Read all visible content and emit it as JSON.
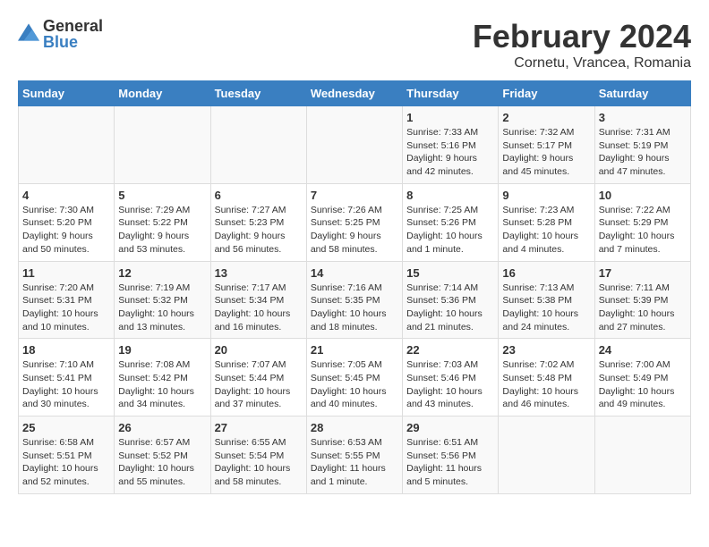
{
  "logo": {
    "text_general": "General",
    "text_blue": "Blue"
  },
  "title": "February 2024",
  "subtitle": "Cornetu, Vrancea, Romania",
  "days_of_week": [
    "Sunday",
    "Monday",
    "Tuesday",
    "Wednesday",
    "Thursday",
    "Friday",
    "Saturday"
  ],
  "weeks": [
    [
      {
        "day": "",
        "info": ""
      },
      {
        "day": "",
        "info": ""
      },
      {
        "day": "",
        "info": ""
      },
      {
        "day": "",
        "info": ""
      },
      {
        "day": "1",
        "info": "Sunrise: 7:33 AM\nSunset: 5:16 PM\nDaylight: 9 hours\nand 42 minutes."
      },
      {
        "day": "2",
        "info": "Sunrise: 7:32 AM\nSunset: 5:17 PM\nDaylight: 9 hours\nand 45 minutes."
      },
      {
        "day": "3",
        "info": "Sunrise: 7:31 AM\nSunset: 5:19 PM\nDaylight: 9 hours\nand 47 minutes."
      }
    ],
    [
      {
        "day": "4",
        "info": "Sunrise: 7:30 AM\nSunset: 5:20 PM\nDaylight: 9 hours\nand 50 minutes."
      },
      {
        "day": "5",
        "info": "Sunrise: 7:29 AM\nSunset: 5:22 PM\nDaylight: 9 hours\nand 53 minutes."
      },
      {
        "day": "6",
        "info": "Sunrise: 7:27 AM\nSunset: 5:23 PM\nDaylight: 9 hours\nand 56 minutes."
      },
      {
        "day": "7",
        "info": "Sunrise: 7:26 AM\nSunset: 5:25 PM\nDaylight: 9 hours\nand 58 minutes."
      },
      {
        "day": "8",
        "info": "Sunrise: 7:25 AM\nSunset: 5:26 PM\nDaylight: 10 hours\nand 1 minute."
      },
      {
        "day": "9",
        "info": "Sunrise: 7:23 AM\nSunset: 5:28 PM\nDaylight: 10 hours\nand 4 minutes."
      },
      {
        "day": "10",
        "info": "Sunrise: 7:22 AM\nSunset: 5:29 PM\nDaylight: 10 hours\nand 7 minutes."
      }
    ],
    [
      {
        "day": "11",
        "info": "Sunrise: 7:20 AM\nSunset: 5:31 PM\nDaylight: 10 hours\nand 10 minutes."
      },
      {
        "day": "12",
        "info": "Sunrise: 7:19 AM\nSunset: 5:32 PM\nDaylight: 10 hours\nand 13 minutes."
      },
      {
        "day": "13",
        "info": "Sunrise: 7:17 AM\nSunset: 5:34 PM\nDaylight: 10 hours\nand 16 minutes."
      },
      {
        "day": "14",
        "info": "Sunrise: 7:16 AM\nSunset: 5:35 PM\nDaylight: 10 hours\nand 18 minutes."
      },
      {
        "day": "15",
        "info": "Sunrise: 7:14 AM\nSunset: 5:36 PM\nDaylight: 10 hours\nand 21 minutes."
      },
      {
        "day": "16",
        "info": "Sunrise: 7:13 AM\nSunset: 5:38 PM\nDaylight: 10 hours\nand 24 minutes."
      },
      {
        "day": "17",
        "info": "Sunrise: 7:11 AM\nSunset: 5:39 PM\nDaylight: 10 hours\nand 27 minutes."
      }
    ],
    [
      {
        "day": "18",
        "info": "Sunrise: 7:10 AM\nSunset: 5:41 PM\nDaylight: 10 hours\nand 30 minutes."
      },
      {
        "day": "19",
        "info": "Sunrise: 7:08 AM\nSunset: 5:42 PM\nDaylight: 10 hours\nand 34 minutes."
      },
      {
        "day": "20",
        "info": "Sunrise: 7:07 AM\nSunset: 5:44 PM\nDaylight: 10 hours\nand 37 minutes."
      },
      {
        "day": "21",
        "info": "Sunrise: 7:05 AM\nSunset: 5:45 PM\nDaylight: 10 hours\nand 40 minutes."
      },
      {
        "day": "22",
        "info": "Sunrise: 7:03 AM\nSunset: 5:46 PM\nDaylight: 10 hours\nand 43 minutes."
      },
      {
        "day": "23",
        "info": "Sunrise: 7:02 AM\nSunset: 5:48 PM\nDaylight: 10 hours\nand 46 minutes."
      },
      {
        "day": "24",
        "info": "Sunrise: 7:00 AM\nSunset: 5:49 PM\nDaylight: 10 hours\nand 49 minutes."
      }
    ],
    [
      {
        "day": "25",
        "info": "Sunrise: 6:58 AM\nSunset: 5:51 PM\nDaylight: 10 hours\nand 52 minutes."
      },
      {
        "day": "26",
        "info": "Sunrise: 6:57 AM\nSunset: 5:52 PM\nDaylight: 10 hours\nand 55 minutes."
      },
      {
        "day": "27",
        "info": "Sunrise: 6:55 AM\nSunset: 5:54 PM\nDaylight: 10 hours\nand 58 minutes."
      },
      {
        "day": "28",
        "info": "Sunrise: 6:53 AM\nSunset: 5:55 PM\nDaylight: 11 hours\nand 1 minute."
      },
      {
        "day": "29",
        "info": "Sunrise: 6:51 AM\nSunset: 5:56 PM\nDaylight: 11 hours\nand 5 minutes."
      },
      {
        "day": "",
        "info": ""
      },
      {
        "day": "",
        "info": ""
      }
    ]
  ]
}
